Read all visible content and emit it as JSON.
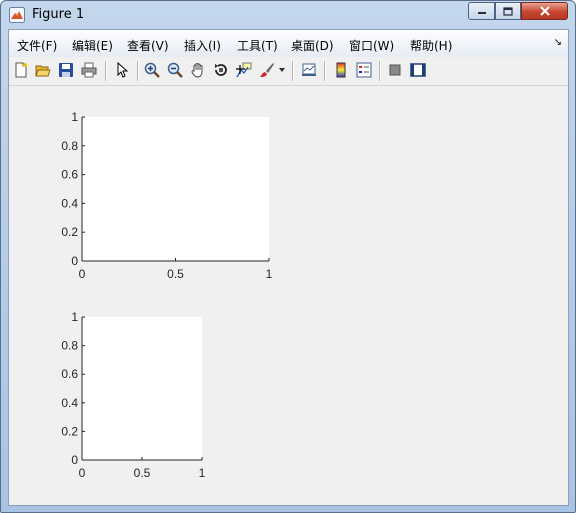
{
  "window": {
    "title": "Figure 1",
    "icon": "matlab-figure-icon"
  },
  "menu": {
    "items": [
      "文件(F)",
      "编辑(E)",
      "查看(V)",
      "插入(I)",
      "工具(T)",
      "桌面(D)",
      "窗口(W)",
      "帮助(H)"
    ]
  },
  "toolbar": {
    "buttons": [
      "new-figure-icon",
      "open-file-icon",
      "save-icon",
      "print-icon",
      "select-arrow-icon",
      "zoom-in-icon",
      "zoom-out-icon",
      "pan-hand-icon",
      "rotate-3d-icon",
      "data-cursor-icon",
      "brush-icon",
      "brush-dropdown-icon",
      "link-plot-icon",
      "colorbar-icon",
      "legend-icon",
      "hide-plot-tools-icon",
      "show-plot-tools-icon"
    ]
  },
  "chart_data": [
    {
      "type": "scatter",
      "title": "",
      "xlabel": "",
      "ylabel": "",
      "xlim": [
        0,
        1
      ],
      "ylim": [
        0,
        1
      ],
      "x_ticks": [
        "0",
        "0.5",
        "1"
      ],
      "y_ticks": [
        "0",
        "0.2",
        "0.4",
        "0.6",
        "0.8",
        "1"
      ],
      "series": [],
      "grid": false
    },
    {
      "type": "scatter",
      "title": "",
      "xlabel": "",
      "ylabel": "",
      "xlim": [
        0,
        1
      ],
      "ylim": [
        0,
        1
      ],
      "x_ticks": [
        "0",
        "0.5",
        "1"
      ],
      "y_ticks": [
        "0",
        "0.2",
        "0.4",
        "0.6",
        "0.8",
        "1"
      ],
      "series": [],
      "grid": false
    }
  ]
}
